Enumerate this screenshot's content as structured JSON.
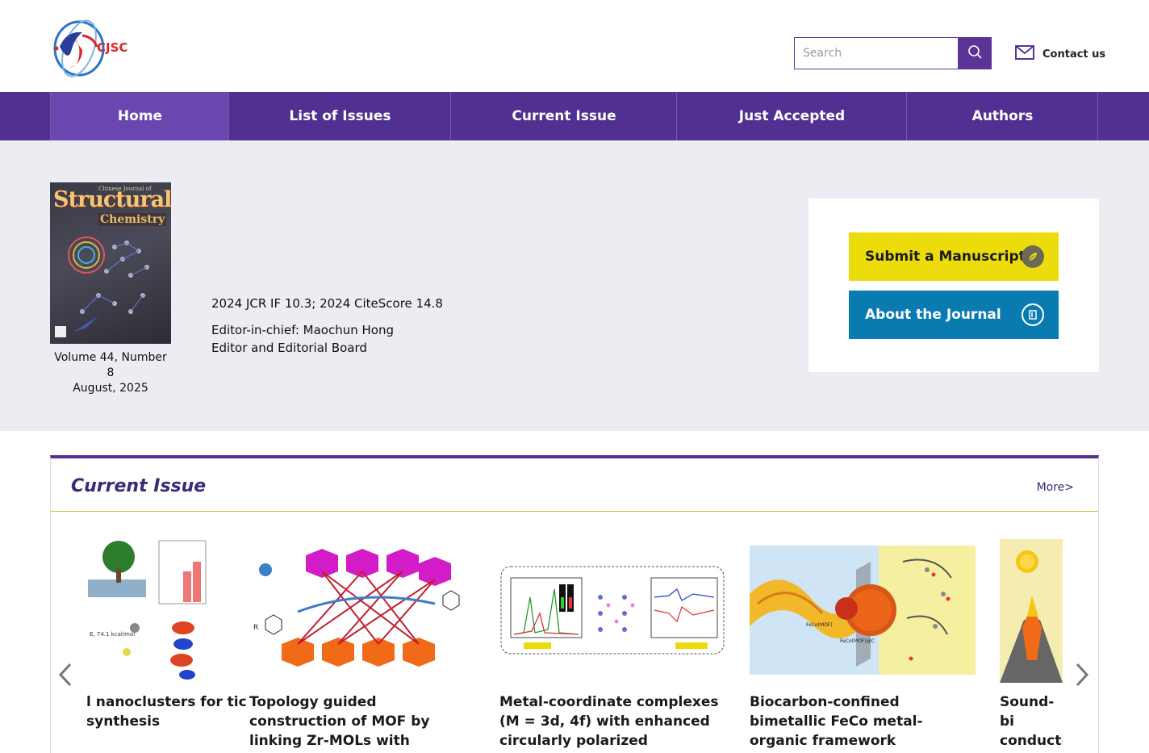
{
  "header": {
    "logo_text": "CJSC",
    "search_placeholder": "Search",
    "contact_label": "Contact us"
  },
  "nav": {
    "items": [
      {
        "label": "Home"
      },
      {
        "label": "List of Issues"
      },
      {
        "label": "Current Issue"
      },
      {
        "label": "Just Accepted"
      },
      {
        "label": "Authors"
      }
    ]
  },
  "hero": {
    "cover_small": "Chinese Journal of",
    "cover_big": "Structural",
    "cover_sub": "Chemistry",
    "volume": "Volume 44, Number 8",
    "date": "August, 2025",
    "impact": "2024 JCR IF 10.3; 2024 CiteScore 14.8",
    "editor": "Editor-in-chief: Maochun Hong",
    "board": "Editor and Editorial Board",
    "submit_label": "Submit a Manuscript",
    "about_label": "About the Journal"
  },
  "current_issue": {
    "title": "Current Issue",
    "more": "More>",
    "articles": [
      {
        "title": "l nanoclusters for tic synthesis"
      },
      {
        "title": "Topology guided construction of MOF by linking Zr-MOLs with perylene diimide motifs for..."
      },
      {
        "title": "Metal-coordinate complexes (M = 3d, 4f) with enhanced circularly polarized luminescence in plana..."
      },
      {
        "title": "Biocarbon-confined bimetallic FeCo metal-organic framework orthogonal nanosheet arrays fo..."
      },
      {
        "title": "Sound-bi conductiv high sens"
      }
    ]
  },
  "colors": {
    "brand_purple": "#513092",
    "submit_yellow": "#ecdc0c",
    "about_blue": "#0a7bb0"
  }
}
